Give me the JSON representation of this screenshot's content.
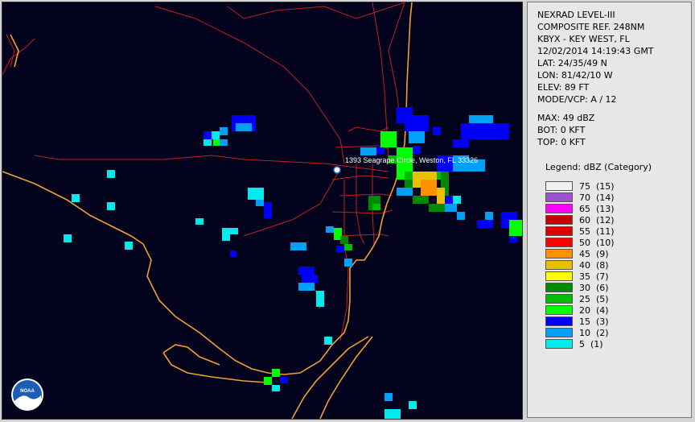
{
  "station": {
    "product": "NEXRAD LEVEL-III",
    "type": "COMPOSITE REF. 248NM",
    "site": "KBYX - KEY WEST, FL",
    "datetime": "12/02/2014 14:19:43 GMT",
    "lat": "LAT: 24/35/49 N",
    "lon": "LON: 81/42/10 W",
    "elev": "ELEV: 89 FT",
    "mode": "MODE/VCP: A / 12"
  },
  "stats": {
    "max": "MAX: 49 dBZ",
    "bot": "BOT: 0 KFT",
    "top": "TOP: 0 KFT"
  },
  "legend": {
    "title": "Legend: dBZ (Category)",
    "items": [
      {
        "label": "75  (15)",
        "color": "#f0f0f0"
      },
      {
        "label": "70  (14)",
        "color": "#9955c9"
      },
      {
        "label": "65  (13)",
        "color": "#ff00ff"
      },
      {
        "label": "60  (12)",
        "color": "#c80000"
      },
      {
        "label": "55  (11)",
        "color": "#dd0000"
      },
      {
        "label": "50  (10)",
        "color": "#ff0000"
      },
      {
        "label": "45  (9)",
        "color": "#ff9000"
      },
      {
        "label": "40  (8)",
        "color": "#e8c000"
      },
      {
        "label": "35  (7)",
        "color": "#ffff00"
      },
      {
        "label": "30  (6)",
        "color": "#008800"
      },
      {
        "label": "25  (5)",
        "color": "#00bb00"
      },
      {
        "label": "20  (4)",
        "color": "#00ff00"
      },
      {
        "label": "15  (3)",
        "color": "#0000f6"
      },
      {
        "label": "10  (2)",
        "color": "#01a0f6"
      },
      {
        "label": "5  (1)",
        "color": "#00ecec"
      }
    ]
  },
  "map": {
    "marker_label": "1393 Seagrape Circle, Weston, FL 33326",
    "logo_text": "NOAA",
    "coast_color": "#f0a030",
    "road_color": "#c02020",
    "background": "#03031e"
  }
}
